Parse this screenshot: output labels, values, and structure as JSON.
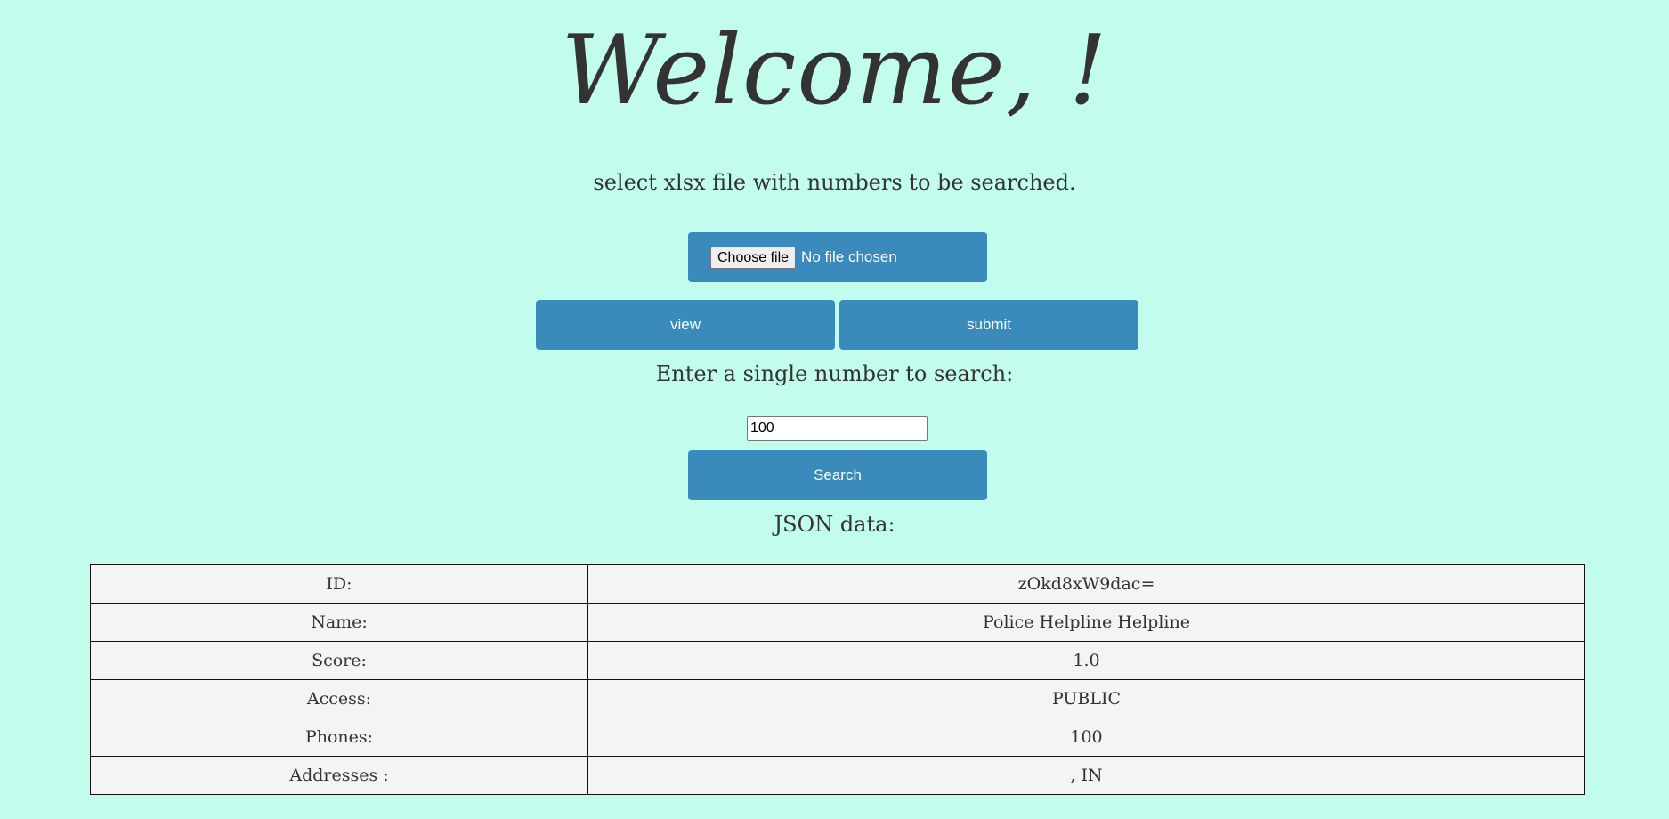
{
  "header": {
    "welcome": "Welcome, !"
  },
  "upload": {
    "instruction": "select xlsx file with numbers to be searched.",
    "choose_file_label": "Choose file",
    "file_status": "No file chosen",
    "view_label": "view",
    "submit_label": "submit"
  },
  "search": {
    "label": "Enter a single number to search:",
    "value": "100",
    "button_label": "Search"
  },
  "results": {
    "title": "JSON data:",
    "rows": [
      {
        "key": "ID:",
        "value": "zOkd8xW9dac="
      },
      {
        "key": "Name:",
        "value": "Police Helpline Helpline"
      },
      {
        "key": "Score:",
        "value": "1.0"
      },
      {
        "key": "Access:",
        "value": "PUBLIC"
      },
      {
        "key": "Phones:",
        "value": "100"
      },
      {
        "key": "Addresses :",
        "value": ", IN"
      }
    ]
  },
  "colors": {
    "background": "#c1fcec",
    "button": "#3a8bbb",
    "text": "#333333",
    "table_cell": "#f5f4f4"
  }
}
